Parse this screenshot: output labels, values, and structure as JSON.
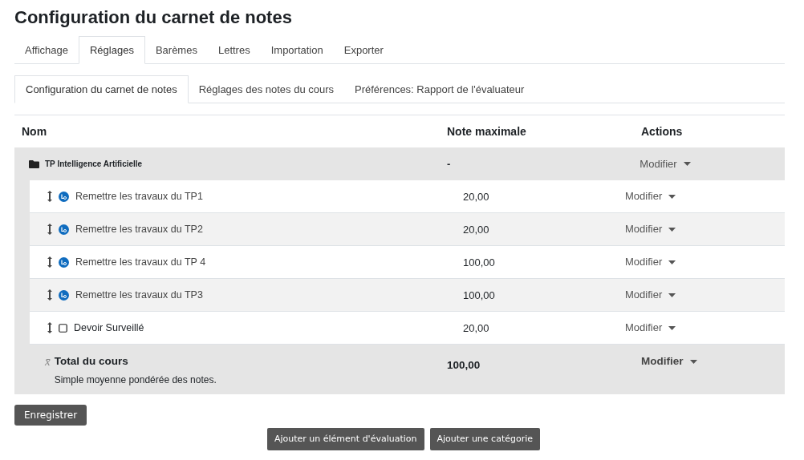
{
  "title": "Configuration du carnet de notes",
  "tabs": [
    {
      "label": "Affichage",
      "selected": false
    },
    {
      "label": "Réglages",
      "selected": true
    },
    {
      "label": "Barèmes",
      "selected": false
    },
    {
      "label": "Lettres",
      "selected": false
    },
    {
      "label": "Importation",
      "selected": false
    },
    {
      "label": "Exporter",
      "selected": false
    }
  ],
  "subtabs": [
    {
      "label": "Configuration du carnet de notes",
      "selected": true
    },
    {
      "label": "Réglages des notes du cours",
      "selected": false
    },
    {
      "label": "Préférences: Rapport de l'évaluateur",
      "selected": false
    }
  ],
  "table": {
    "columns": [
      "Nom",
      "Note maximale",
      "Actions"
    ],
    "category": {
      "name": "TP Intelligence Artificielle",
      "max": "-",
      "action": "Modifier"
    },
    "rows": [
      {
        "kind": "assignment",
        "name": "Remettre les travaux du TP1",
        "max": "20,00",
        "action": "Modifier"
      },
      {
        "kind": "assignment",
        "name": "Remettre les travaux du TP2",
        "max": "20,00",
        "action": "Modifier"
      },
      {
        "kind": "assignment",
        "name": "Remettre les travaux du TP 4",
        "max": "100,00",
        "action": "Modifier"
      },
      {
        "kind": "assignment",
        "name": "Remettre les travaux du TP3",
        "max": "100,00",
        "action": "Modifier"
      },
      {
        "kind": "manual",
        "name": "Devoir Surveillé",
        "max": "20,00",
        "action": "Modifier"
      }
    ],
    "total": {
      "symbol": "x̄",
      "name": "Total du cours",
      "description": "Simple moyenne pondérée des notes.",
      "max": "100,00",
      "action": "Modifier"
    }
  },
  "save_button": "Enregistrer",
  "buttons": [
    "Ajouter un élément d'évaluation",
    "Ajouter une catégorie"
  ]
}
